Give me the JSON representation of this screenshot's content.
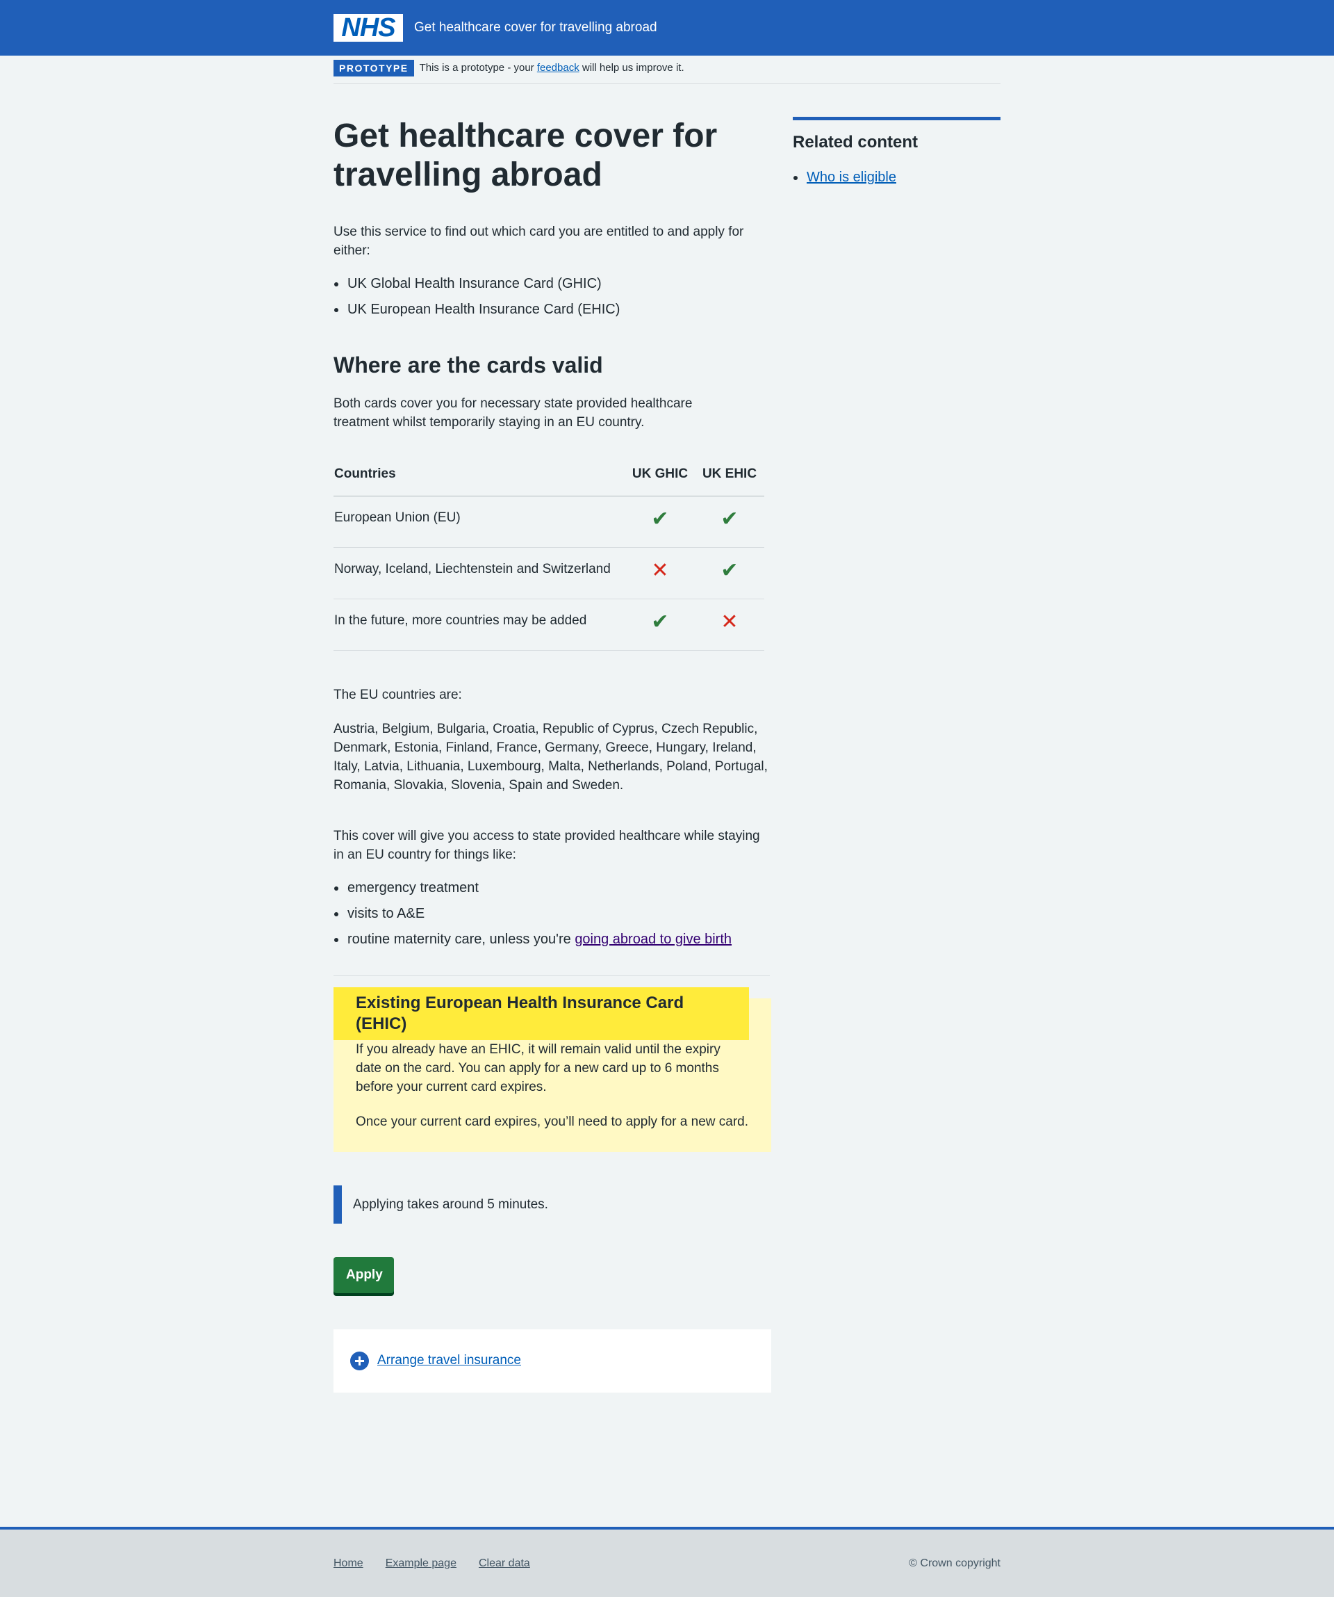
{
  "header": {
    "logo_text": "NHS",
    "service_name": "Get healthcare cover for travelling abroad"
  },
  "prototype_banner": {
    "tag": "PROTOTYPE",
    "text_before": "This is a prototype - your ",
    "link": "feedback",
    "text_after": " will help us improve it."
  },
  "main": {
    "title": "Get healthcare cover for travelling abroad",
    "intro": "Use this service to find out which card you are entitled to and apply for either:",
    "cards": [
      "UK Global Health Insurance Card (GHIC)",
      "UK European Health Insurance Card (EHIC)"
    ],
    "valid_heading": "Where are the cards valid",
    "valid_text": "Both cards cover you for necessary state provided healthcare treatment whilst temporarily staying in an EU country.",
    "table": {
      "headers": [
        "Countries",
        "UK GHIC",
        "UK EHIC"
      ],
      "rows": [
        {
          "country": "European Union (EU)",
          "ghic": "yes",
          "ehic": "yes"
        },
        {
          "country": "Norway, Iceland, Liechtenstein and Switzerland",
          "ghic": "no",
          "ehic": "yes"
        },
        {
          "country": "In the future, more countries may be added",
          "ghic": "yes",
          "ehic": "no"
        }
      ]
    },
    "eu_label": "The EU countries are:",
    "eu_countries": "Austria, Belgium, Bulgaria, Croatia, Republic of Cyprus, Czech Republic, Denmark, Estonia, Finland, France, Germany, Greece, Hungary, Ireland, Italy, Latvia, Lithuania, Luxembourg, Malta, Netherlands, Poland, Portugal, Romania, Slovakia, Slovenia, Spain and Sweden.",
    "cover_text": "This cover will give you access to state provided healthcare while staying in an EU country for things like:",
    "cover_items": {
      "item1": "emergency treatment",
      "item2": "visits to A&E",
      "item3_text": "routine maternity care, unless you're ",
      "item3_link": "going abroad to give birth"
    },
    "callout": {
      "heading": "Existing European Health Insurance Card (EHIC)",
      "para1": "If you already have an EHIC, it will remain valid until the expiry date on the card. You can apply for a new card up to 6 months before your current card expires.",
      "para2": "Once your current card expires, you’ll need to apply for a new card."
    },
    "inset_text": "Applying takes around 5 minutes.",
    "apply_button": "Apply",
    "details_link": "Arrange travel insurance"
  },
  "sidebar": {
    "title": "Related content",
    "links": [
      "Who is eligible"
    ]
  },
  "footer": {
    "links": [
      "Home",
      "Example page",
      "Clear data"
    ],
    "copyright": "© Crown copyright"
  },
  "colors": {
    "header_blue": "#205fb8",
    "link_blue": "#005eb8",
    "tick_green": "#2f7d3d",
    "cross_red": "#d5281b",
    "button_green": "#217a3c",
    "callout_yellow": "#fff9c4",
    "callout_heading_yellow": "#ffeb3b"
  },
  "icons": {
    "yes": "tick-icon",
    "no": "cross-icon",
    "details": "plus-circle-icon"
  }
}
